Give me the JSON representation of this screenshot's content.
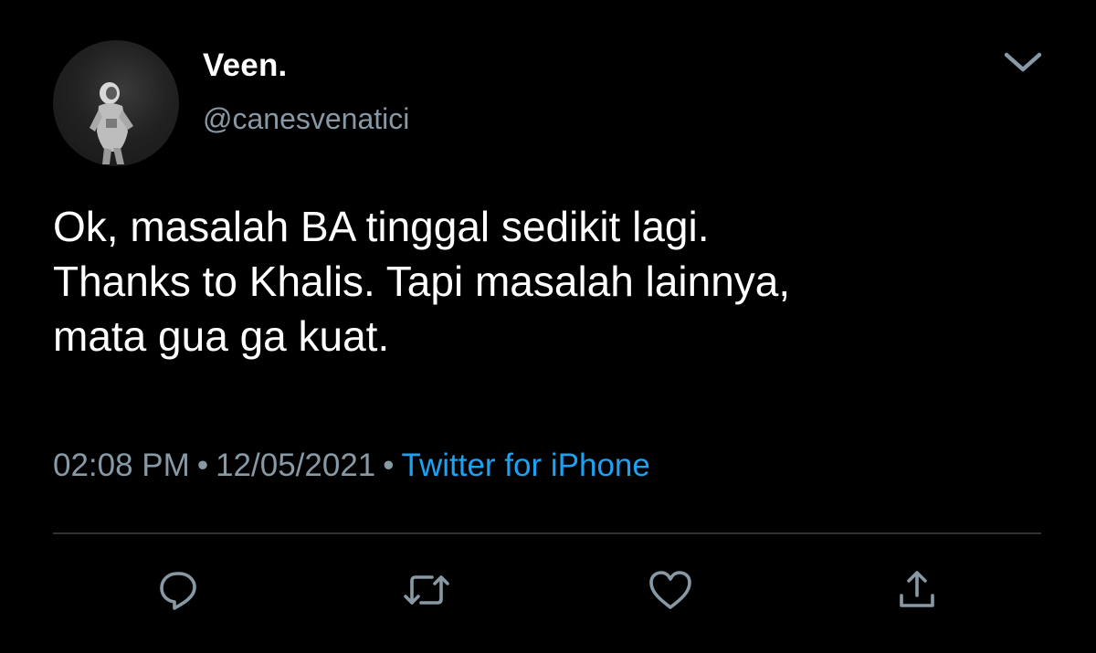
{
  "tweet": {
    "display_name": "Veen.",
    "handle": "@canesvenatici",
    "text": "Ok, masalah BA tinggal sedikit lagi.\nThanks to Khalis. Tapi masalah lainnya,\nmata gua ga kuat.",
    "time": "02:08 PM",
    "separator": "•",
    "date": "12/05/2021",
    "source": "Twitter for iPhone"
  },
  "icons": {
    "menu": "chevron-down-icon",
    "reply": "reply-icon",
    "retweet": "retweet-icon",
    "like": "heart-icon",
    "share": "share-icon"
  },
  "colors": {
    "background": "#000000",
    "text": "#ffffff",
    "secondary": "#8899a6",
    "link": "#1da1f2",
    "divider": "#2f3336"
  }
}
